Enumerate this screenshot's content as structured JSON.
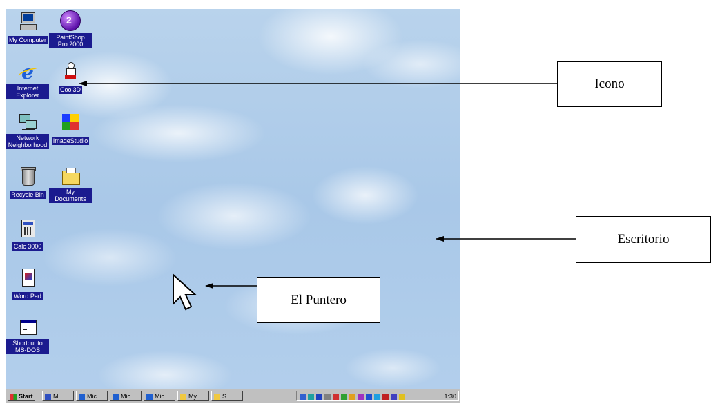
{
  "desktop": {
    "icons": [
      {
        "name": "my-computer-icon",
        "label": "My Computer"
      },
      {
        "name": "ball-icon",
        "label": "PaintShop Pro 2000"
      },
      {
        "name": "internet-explorer-icon",
        "label": "Internet Explorer"
      },
      {
        "name": "figure-icon",
        "label": "Cool3D"
      },
      {
        "name": "network-icon",
        "label": "Network Neighborhood"
      },
      {
        "name": "image-studio-icon",
        "label": "ImageStudio"
      },
      {
        "name": "recycle-bin-icon",
        "label": "Recycle Bin"
      },
      {
        "name": "my-documents-icon",
        "label": "My Documents"
      },
      {
        "name": "calculator-icon",
        "label": "Calc 3000"
      },
      {
        "name": "document-icon",
        "label": "Word Pad"
      },
      {
        "name": "window-icon",
        "label": "Shortcut to MS-DOS"
      }
    ]
  },
  "taskbar": {
    "start_label": "Start",
    "buttons": [
      {
        "label": "Mi..."
      },
      {
        "label": "Mic..."
      },
      {
        "label": "Mic..."
      },
      {
        "label": "Mic..."
      },
      {
        "label": "My..."
      },
      {
        "label": "S..."
      }
    ],
    "clock": "1:30"
  },
  "callouts": {
    "icono": "Icono",
    "escritorio": "Escritorio",
    "puntero": "El Puntero"
  }
}
